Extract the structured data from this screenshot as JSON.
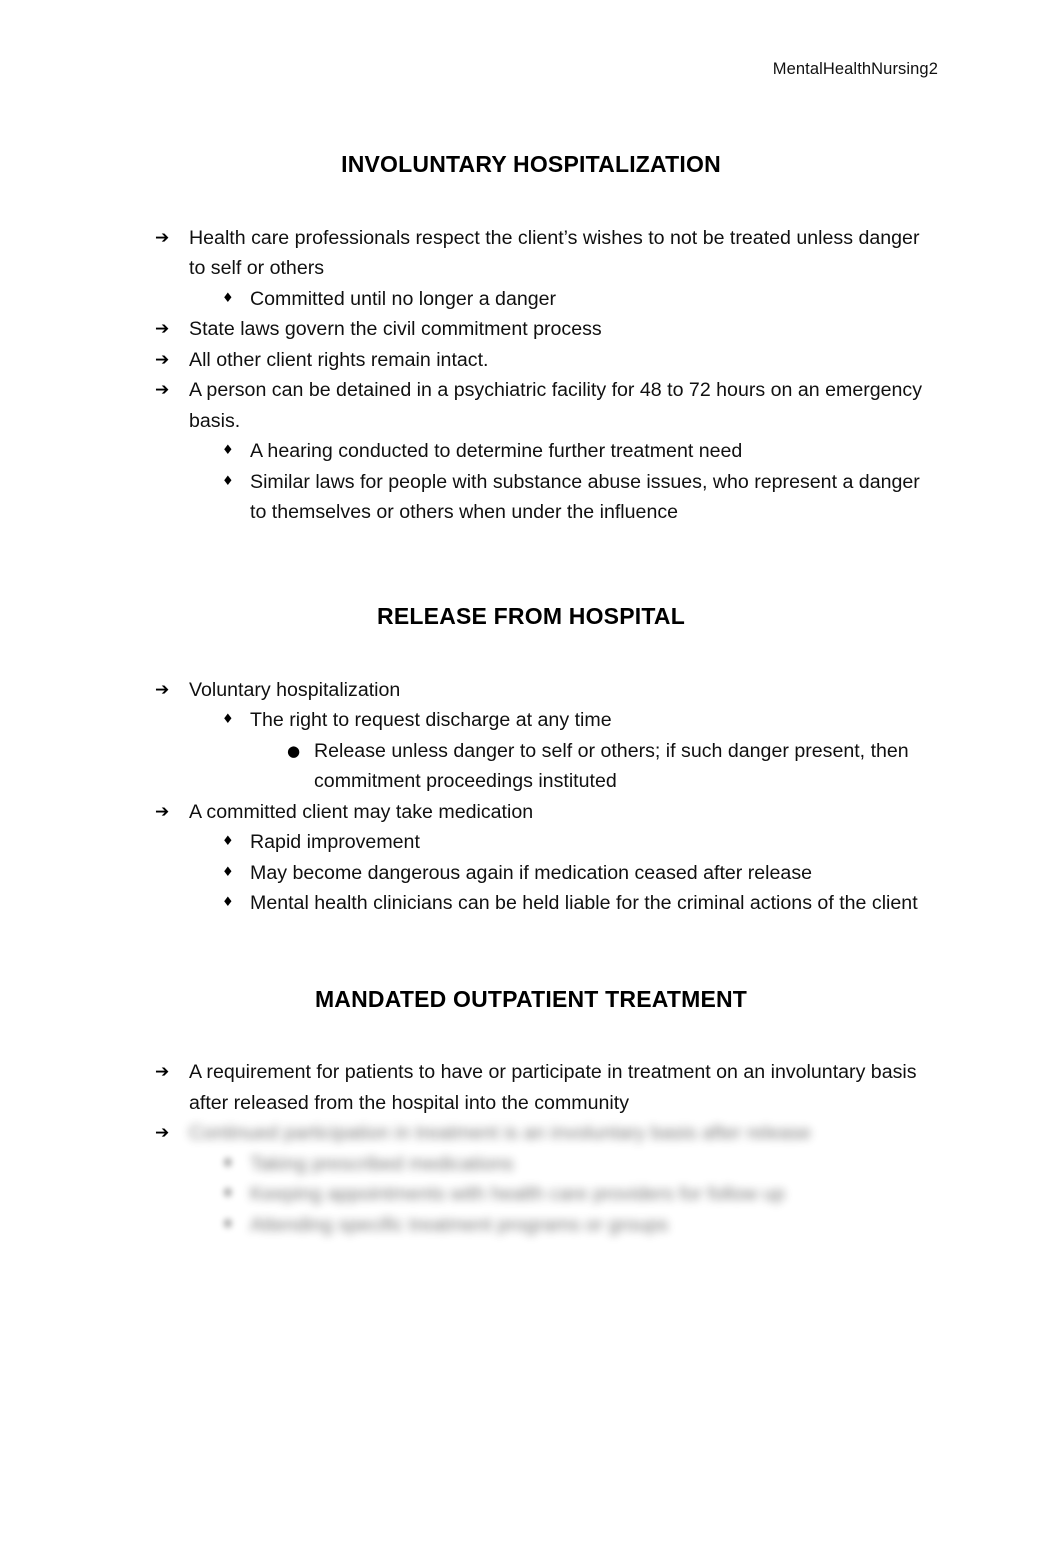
{
  "document": {
    "header": "MentalHealthNursing2",
    "page_background": "#ffffff",
    "text_color": "#101010"
  },
  "bullets": {
    "level1": "➔",
    "level2": "♦",
    "level3": "●"
  },
  "sections": [
    {
      "heading": "INVOLUNTARY HOSPITALIZATION",
      "items": [
        {
          "level": 1,
          "text": "Health care professionals respect the client’s wishes to not be treated unless danger to self or others"
        },
        {
          "level": 2,
          "text": "Committed until no longer a danger"
        },
        {
          "level": 1,
          "text": "State laws govern the civil commitment process"
        },
        {
          "level": 1,
          "text": "All other client rights remain intact."
        },
        {
          "level": 1,
          "text": "A person can be detained in a psychiatric facility for 48 to 72 hours on an emergency basis."
        },
        {
          "level": 2,
          "text": "A hearing conducted to determine further treatment need"
        },
        {
          "level": 2,
          "text": "Similar laws for people with substance abuse issues, who represent a danger to themselves or others when under the influence"
        }
      ]
    },
    {
      "heading": "RELEASE FROM HOSPITAL",
      "items": [
        {
          "level": 1,
          "text": "Voluntary hospitalization"
        },
        {
          "level": 2,
          "text": "The right to request discharge at any time"
        },
        {
          "level": 3,
          "text": "Release unless danger to self or others; if such danger present, then commitment proceedings instituted"
        },
        {
          "level": 1,
          "text": "A committed client may take medication"
        },
        {
          "level": 2,
          "text": "Rapid improvement"
        },
        {
          "level": 2,
          "text": "May become dangerous again if medication ceased after release"
        },
        {
          "level": 2,
          "text": "Mental health clinicians can be held liable for the criminal actions of the client"
        }
      ]
    },
    {
      "heading": "MANDATED OUTPATIENT TREATMENT",
      "items": [
        {
          "level": 1,
          "text": "A requirement for patients to have or participate in treatment on an involuntary basis after released from the hospital into the community"
        }
      ],
      "obscured_items": [
        {
          "level": 1,
          "text": "Continued participation in treatment is an involuntary basis after release"
        },
        {
          "level": 2,
          "text": "Taking prescribed medications"
        },
        {
          "level": 2,
          "text": "Keeping appointments with health care providers for follow up"
        },
        {
          "level": 2,
          "text": "Attending specific treatment programs or groups"
        }
      ]
    }
  ]
}
